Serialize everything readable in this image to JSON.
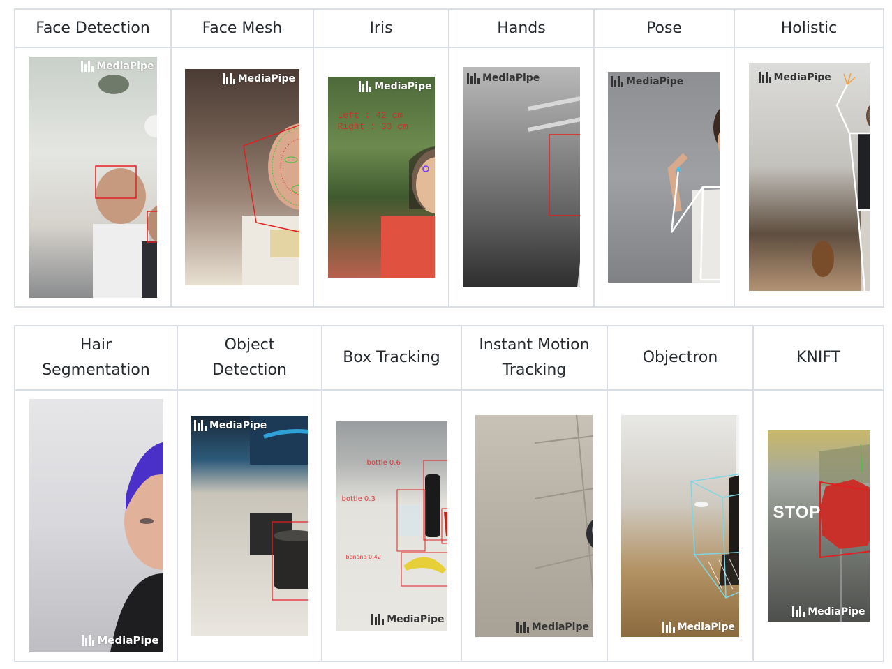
{
  "brand": "MediaPipe",
  "row1": [
    {
      "title": "Face Detection",
      "icon": "face-detection-demo"
    },
    {
      "title": "Face Mesh",
      "icon": "face-mesh-demo"
    },
    {
      "title": "Iris",
      "icon": "iris-demo",
      "overlay": [
        "Left : 42 cm",
        "Right : 33 cm"
      ]
    },
    {
      "title": "Hands",
      "icon": "hands-demo"
    },
    {
      "title": "Pose",
      "icon": "pose-demo"
    },
    {
      "title": "Holistic",
      "icon": "holistic-demo"
    }
  ],
  "row2": [
    {
      "title_lines": [
        "Hair",
        "Segmentation"
      ],
      "icon": "hair-segmentation-demo"
    },
    {
      "title_lines": [
        "Object",
        "Detection"
      ],
      "icon": "object-detection-demo"
    },
    {
      "title_lines": [
        "Box Tracking"
      ],
      "icon": "box-tracking-demo",
      "labels": [
        "bottle 0.6",
        "bottle 0.3",
        "banana 0.42"
      ]
    },
    {
      "title_lines": [
        "Instant Motion",
        "Tracking"
      ],
      "icon": "instant-motion-tracking-demo"
    },
    {
      "title_lines": [
        "Objectron"
      ],
      "icon": "objectron-demo"
    },
    {
      "title_lines": [
        "KNIFT"
      ],
      "icon": "knift-demo",
      "sign": "STOP"
    }
  ],
  "colors": {
    "border": "#d8dee4",
    "text": "#24292e",
    "detect_red": "#e02020",
    "mesh_green": "#3fc43f",
    "pose_white": "#ffffff",
    "objectron_cyan": "#7fd6e0"
  }
}
